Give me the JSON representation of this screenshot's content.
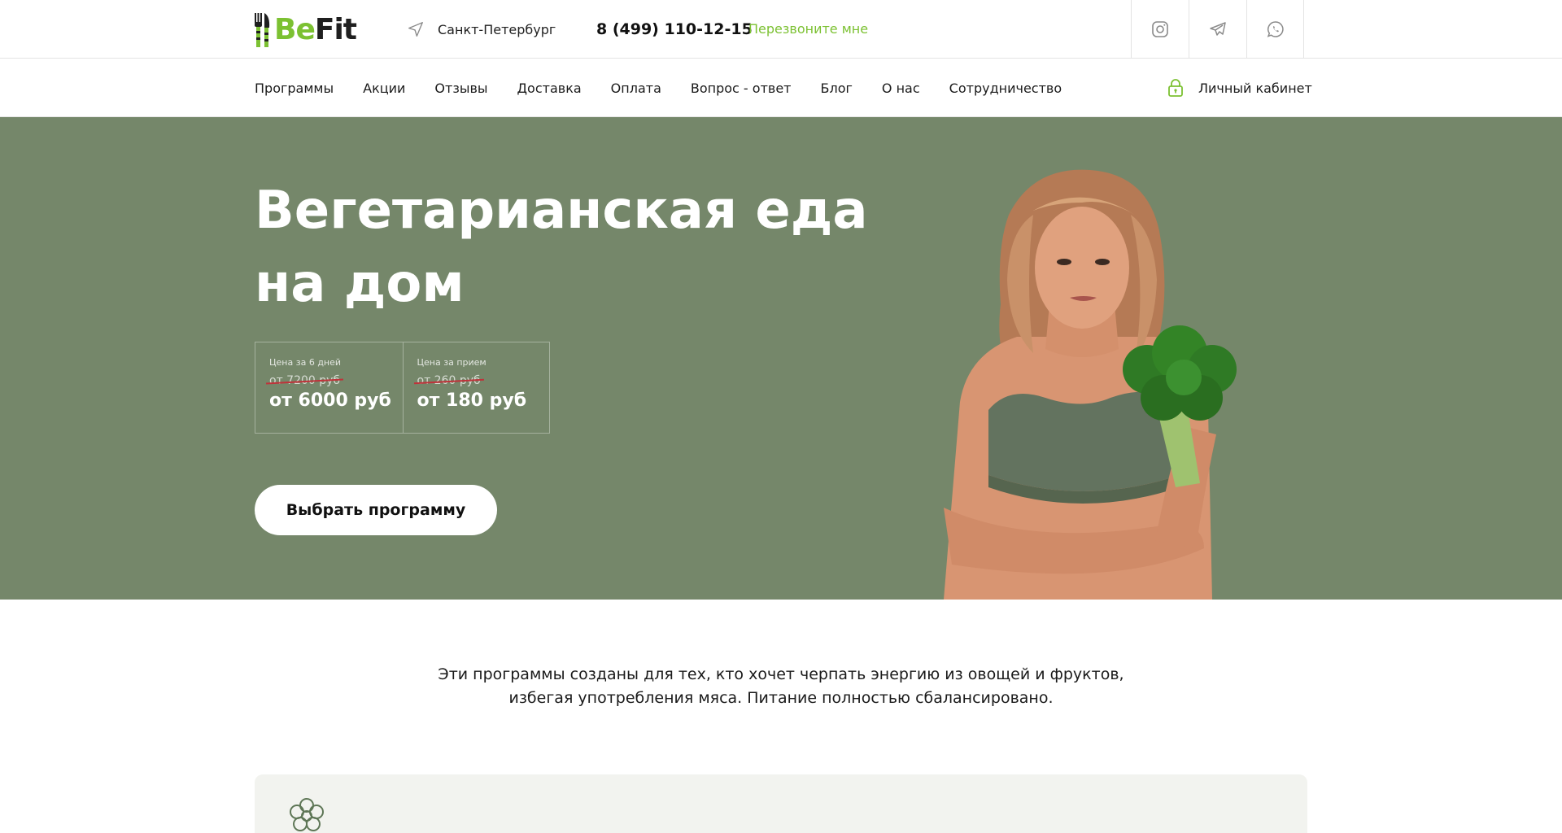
{
  "header": {
    "logo": {
      "part1": "Be",
      "part2": "Fit"
    },
    "city": "Санкт-Петербург",
    "phone": "8 (499) 110-12-15",
    "callback": "Перезвоните мне",
    "socials": [
      "instagram-icon",
      "telegram-icon",
      "whatsapp-icon"
    ]
  },
  "nav": {
    "items": [
      "Программы",
      "Акции",
      "Отзывы",
      "Доставка",
      "Оплата",
      "Вопрос - ответ",
      "Блог",
      "О нас",
      "Сотрудничество"
    ],
    "cabinet": "Личный кабинет"
  },
  "hero": {
    "title_line1": "Вегетарианская еда",
    "title_line2": "на дом",
    "prices": [
      {
        "label": "Цена за 6 дней",
        "old": "от 7200 руб",
        "new": "от 6000 руб"
      },
      {
        "label": "Цена за прием",
        "old": "от 260 руб",
        "new": "от 180 руб"
      }
    ],
    "cta": "Выбрать программу"
  },
  "intro": {
    "line1": "Эти программы созданы для тех, кто хочет черпать энергию из овощей и фруктов,",
    "line2": "избегая употребления мяса. Питание полностью сбалансировано."
  },
  "colors": {
    "accent": "#7cc132",
    "hero_bg": "#75876a",
    "card_bg": "#f2f3ef"
  }
}
